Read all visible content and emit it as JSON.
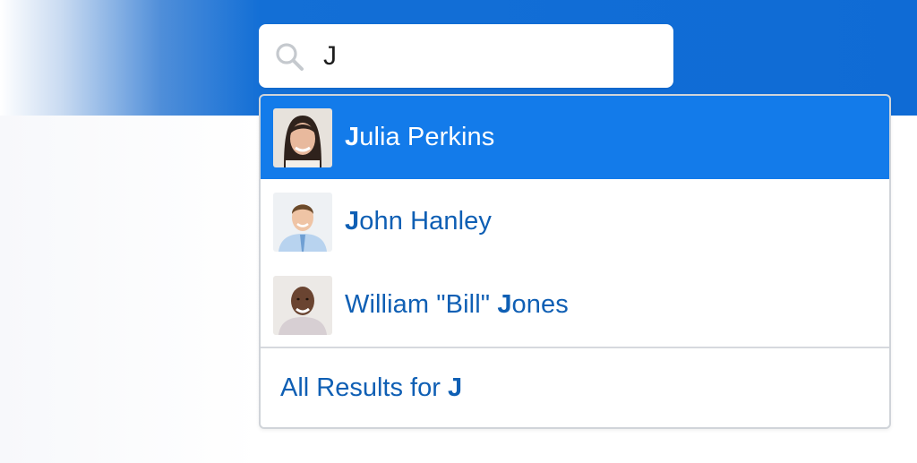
{
  "search": {
    "query": "J",
    "icon": "search-icon"
  },
  "results": [
    {
      "match": "J",
      "rest": "ulia Perkins",
      "avatar": "woman-portrait-avatar"
    },
    {
      "match": "J",
      "rest": "ohn Hanley",
      "avatar": "man-portrait-avatar"
    },
    {
      "prefix": "William \"Bill\" ",
      "match": "J",
      "rest": "ones",
      "avatar": "man-portrait-avatar"
    }
  ],
  "all_results": {
    "label": "All Results for ",
    "query": "J"
  },
  "colors": {
    "brand_blue": "#0f6bd5",
    "highlight": "#137bea",
    "link": "#0f5fb4"
  }
}
